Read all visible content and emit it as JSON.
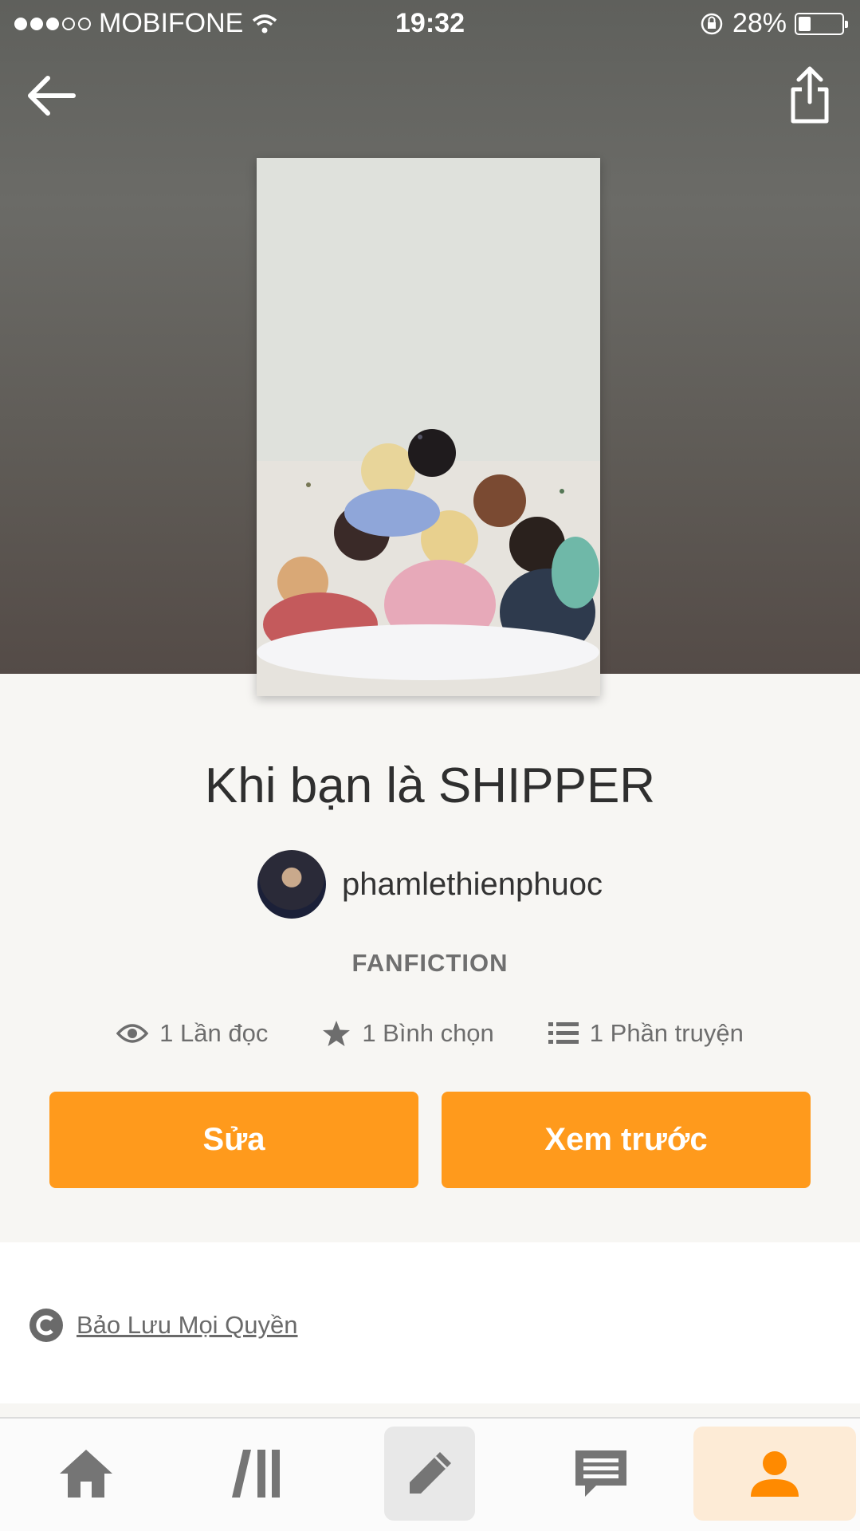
{
  "status_bar": {
    "carrier": "MOBIFONE",
    "time": "19:32",
    "battery_percent": "28%",
    "battery_level": 0.28
  },
  "header": {
    "back_icon": "arrow-left-icon",
    "share_icon": "share-icon"
  },
  "story": {
    "title": "Khi bạn là SHIPPER",
    "author": "phamlethienphuoc",
    "genre": "FANFICTION",
    "stats": {
      "reads": "1 Lần đọc",
      "votes": "1 Bình chọn",
      "parts": "1 Phần truyện"
    }
  },
  "actions": {
    "edit_label": "Sửa",
    "preview_label": "Xem trước"
  },
  "copyright": {
    "label": "Bảo Lưu Mọi Quyền"
  },
  "tabbar": {
    "items": [
      {
        "icon": "home-icon"
      },
      {
        "icon": "library-icon"
      },
      {
        "icon": "pencil-icon"
      },
      {
        "icon": "chat-icon"
      },
      {
        "icon": "profile-icon"
      }
    ]
  },
  "colors": {
    "accent": "#ff9a1c",
    "hero_bg": "#5f605c",
    "active_tab_bg": "#fdebd6"
  }
}
